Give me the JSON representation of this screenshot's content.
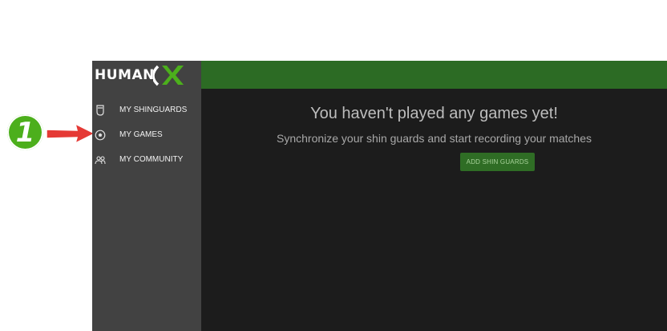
{
  "callout": {
    "number": "1",
    "color": "#4caf1c",
    "arrow_color": "#e53935"
  },
  "logo": {
    "text": "HUMAN",
    "mark": "X"
  },
  "sidebar": {
    "items": [
      {
        "label": "MY SHINGUARDS",
        "icon": "shinguard-icon"
      },
      {
        "label": "MY GAMES",
        "icon": "soccer-ball-icon"
      },
      {
        "label": "MY COMMUNITY",
        "icon": "community-icon"
      }
    ]
  },
  "main": {
    "empty_title": "You haven't played any games yet!",
    "empty_subtitle": "Synchronize your shin guards and start recording your matches",
    "add_button_label": "ADD SHIN GUARDS"
  },
  "colors": {
    "sidebar_bg": "#424242",
    "content_bg": "#1c1c1c",
    "topbar": "#2c6b24",
    "accent_green": "#4caf1c"
  }
}
